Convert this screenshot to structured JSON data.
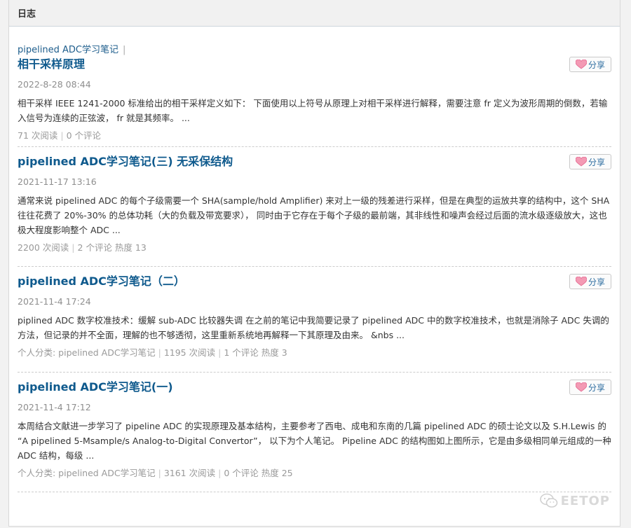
{
  "panel": {
    "title": "日志"
  },
  "category_link": "pipelined ADC学习笔记",
  "category_sep": "|",
  "share_label": "分享",
  "colors": {
    "link": "#0f5a8d",
    "heart": "#f07aa0",
    "meta": "#999999"
  },
  "posts": [
    {
      "title": "相干采样原理",
      "date": "2022-8-28 08:44",
      "excerpt": "相干采样 IEEE 1241-2000 标准给出的相干采样定义如下： 下面使用以上符号从原理上对相干采样进行解释，需要注意 fr 定义为波形周期的倒数，若输入信号为连续的正弦波， fr 就是其频率。 ...",
      "meta": [
        "71 次阅读",
        "0 个评论"
      ]
    },
    {
      "title": "pipelined ADC学习笔记(三) 无采保结构",
      "date": "2021-11-17 13:16",
      "excerpt": "通常来说 pipelined ADC 的每个子级需要一个 SHA(sample/hold Amplifier) 来对上一级的残差进行采样，但是在典型的运放共享的结构中，这个 SHA 往往花费了 20%-30% 的总体功耗（大的负载及带宽要求）， 同时由于它存在于每个子级的最前端，其非线性和噪声会经过后面的流水级逐级放大，这也极大程度影响整个 ADC ...",
      "meta": [
        "2200 次阅读",
        "2 个评论 热度 13"
      ]
    },
    {
      "title": "pipelined ADC学习笔记（二）",
      "date": "2021-11-4 17:24",
      "excerpt": "piplined ADC 数字校准技术：缓解 sub-ADC 比较器失调 在之前的笔记中我简要记录了 pipelined ADC 中的数字校准技术，也就是消除子 ADC 失调的方法，但记录的并不全面，理解的也不够透彻，这里重新系统地再解释一下其原理及由来。 &nbs ...",
      "meta": [
        "个人分类: pipelined ADC学习笔记",
        "1195 次阅读",
        "1 个评论 热度 3"
      ]
    },
    {
      "title": "pipelined ADC学习笔记(一)",
      "date": "2021-11-4 17:12",
      "excerpt": "本周结合文献进一步学习了 pipeline ADC 的实现原理及基本结构，主要参考了西电、成电和东南的几篇 pipelined ADC 的硕士论文以及 S.H.Lewis 的 “A pipelined 5-Msample/s Analog-to-Digital Convertor”， 以下为个人笔记。 Pipeline ADC 的结构图如上图所示，它是由多级相同单元组成的一种 ADC 结构，每级 ...",
      "meta": [
        "个人分类: pipelined ADC学习笔记",
        "3161 次阅读",
        "0 个评论 热度 25"
      ]
    }
  ],
  "watermark": {
    "icon": "wechat-icon",
    "text": "EETOP"
  }
}
